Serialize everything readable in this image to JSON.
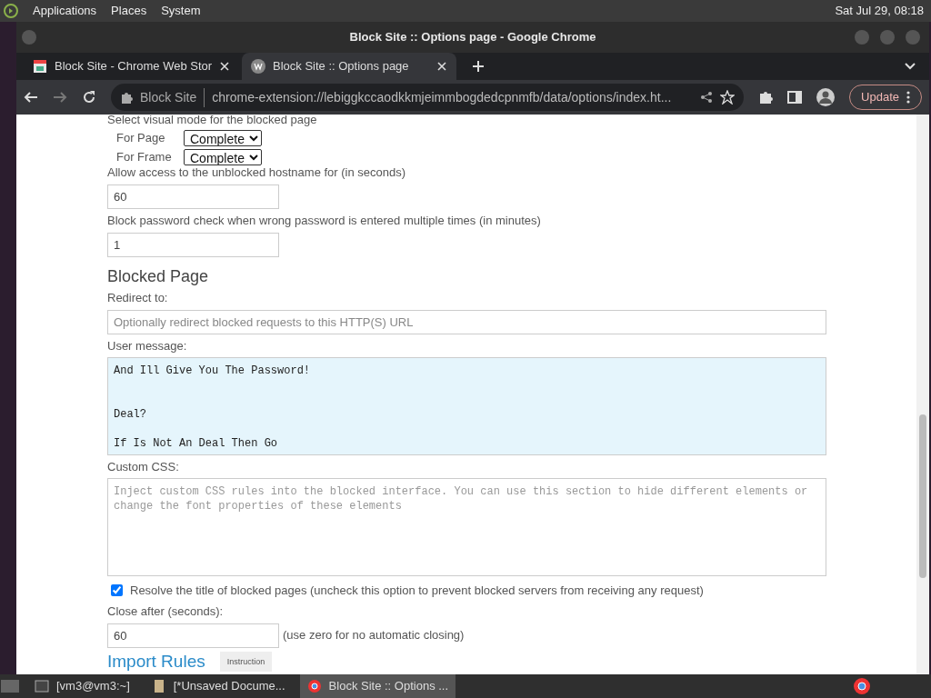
{
  "panel": {
    "menus": [
      "Applications",
      "Places",
      "System"
    ],
    "clock": "Sat Jul 29, 08:18"
  },
  "window": {
    "title": "Block Site :: Options page - Google Chrome"
  },
  "tabs": [
    {
      "label": "Block Site - Chrome Web Stor",
      "selected": false
    },
    {
      "label": "Block Site :: Options page",
      "selected": true
    }
  ],
  "toolbar": {
    "site_chip": "Block Site",
    "url": "chrome-extension://lebiggkccaodkkmjeimmbogdedcpnmfb/data/options/index.ht...",
    "update_button": "Update"
  },
  "content": [
    {
      "kind": "label",
      "text": "Select visual mode for the blocked page"
    },
    {
      "kind": "select",
      "label": "For Page",
      "value": "Complete"
    },
    {
      "kind": "select",
      "label": "For Frame",
      "value": "Complete"
    },
    {
      "kind": "label",
      "text": "Allow access to the unblocked hostname for (in seconds)"
    },
    {
      "kind": "input",
      "value": "60"
    },
    {
      "kind": "label",
      "text": "Block password check when wrong password is entered multiple times (in minutes)"
    },
    {
      "kind": "input",
      "value": "1"
    },
    {
      "kind": "heading",
      "text": "Blocked Page"
    },
    {
      "kind": "label",
      "text": "Redirect to:"
    },
    {
      "kind": "input",
      "placeholder": "Optionally redirect blocked requests to this HTTP(S) URL",
      "wide": true
    },
    {
      "kind": "label",
      "text": "User message:"
    },
    {
      "kind": "textarea",
      "value": "And Ill Give You The Password!\n\n\nDeal?\n\nIf Is Not An Deal Then Go",
      "focused": true
    },
    {
      "kind": "label",
      "text": "Custom CSS:"
    },
    {
      "kind": "textarea",
      "placeholder": "Inject custom CSS rules into the blocked interface. You can use this section to hide different elements or change the font properties of these elements",
      "focused": false
    },
    {
      "kind": "checkbox",
      "label": "Resolve the title of blocked pages (uncheck this option to prevent blocked servers from receiving any request)",
      "checked": true
    },
    {
      "kind": "label",
      "text": "Close after (seconds):"
    },
    {
      "kind": "input",
      "value": "60",
      "note": "(use zero for no automatic closing)"
    },
    {
      "kind": "section",
      "text": "Import Rules",
      "button": "Instruction"
    }
  ],
  "taskbar": [
    {
      "label": "[vm3@vm3:~]",
      "selected": false
    },
    {
      "label": "[*Unsaved Docume...",
      "selected": false
    },
    {
      "label": "Block Site :: Options ...",
      "selected": true
    }
  ]
}
